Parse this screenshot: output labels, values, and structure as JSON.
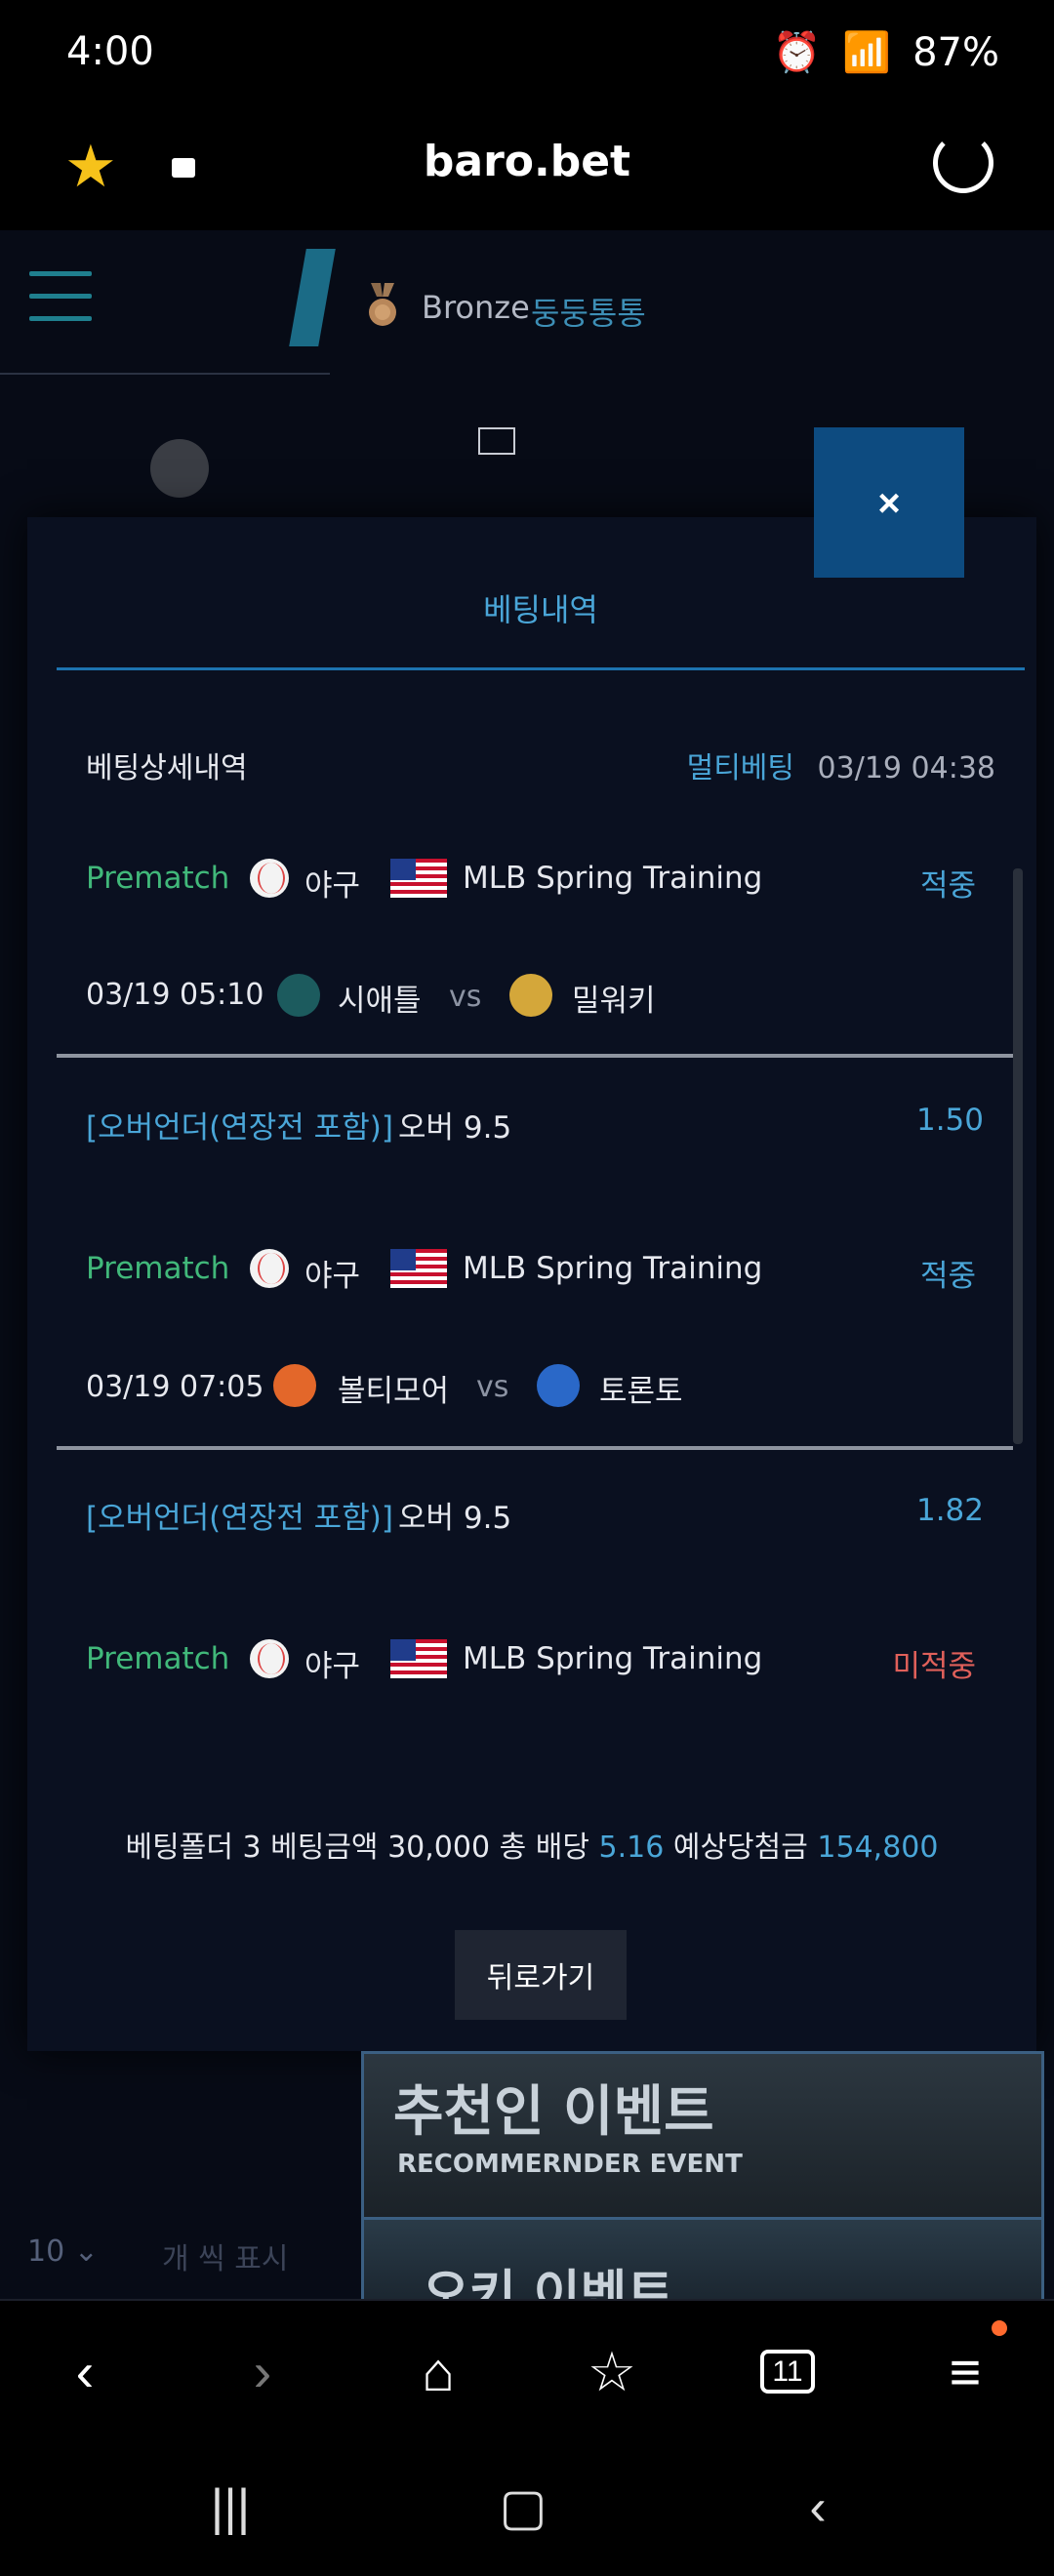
{
  "statusbar": {
    "time": "4:00",
    "battery": "87%"
  },
  "browser": {
    "url": "baro.bet"
  },
  "header": {
    "tier": "Bronze",
    "nickname": "둥둥통통"
  },
  "modal": {
    "tab_label": "베팅내역",
    "detail_title": "베팅상세내역",
    "bet_type": "멀티베팅",
    "bet_datetime": "03/19 04:38",
    "close_label": "×",
    "matches": [
      {
        "prematch": "Prematch",
        "sport": "야구",
        "league": "MLB Spring Training",
        "status": "적중",
        "datetime": "03/19 05:10",
        "home": "시애틀",
        "vs": "vs",
        "away": "밀워키",
        "market": "[오버언더(연장전 포함)]",
        "pick": "오버 9.5",
        "odds": "1.50"
      },
      {
        "prematch": "Prematch",
        "sport": "야구",
        "league": "MLB Spring Training",
        "status": "적중",
        "datetime": "03/19 07:05",
        "home": "볼티모어",
        "vs": "vs",
        "away": "토론토",
        "market": "[오버언더(연장전 포함)]",
        "pick": "오버 9.5",
        "odds": "1.82"
      },
      {
        "prematch": "Prematch",
        "sport": "야구",
        "league": "MLB Spring Training",
        "status": "미적중"
      }
    ],
    "summary": {
      "folder_label": "베팅폴더",
      "folder_count": "3",
      "amount_label": "베팅금액",
      "amount": "30,000",
      "odds_label": "총 배당",
      "total_odds": "5.16",
      "win_label": "예상당첨금",
      "expected_win": "154,800"
    },
    "back_label": "뒤로가기"
  },
  "banners": {
    "event1_title": "추천인 이벤트",
    "event1_sub": "RECOMMERNDER EVENT",
    "event2_title": "오키 이벤트"
  },
  "paging": {
    "per_page_value": "10",
    "per_page_label": "개 씩 표시"
  },
  "toolbar": {
    "tabs_count": "11"
  }
}
